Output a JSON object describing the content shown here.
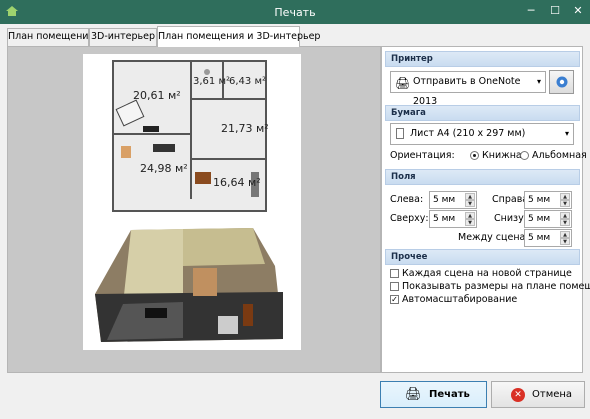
{
  "window": {
    "title": "Печать"
  },
  "tabs": [
    "План помещения",
    "3D-интерьер",
    "План помещения и 3D-интерьер"
  ],
  "preview": {
    "rooms": [
      "20,61 м²",
      "3,61 м²",
      "6,43 м²",
      "21,73 м²",
      "24,98 м²",
      "16,64 м²"
    ]
  },
  "printer": {
    "header": "Принтер",
    "selected": "Отправить в OneNote 2013"
  },
  "paper": {
    "header": "Бумага",
    "selected": "Лист A4 (210 x 297 мм)",
    "orientation_label": "Ориентация:",
    "portrait": "Книжная",
    "landscape": "Альбомная"
  },
  "margins": {
    "header": "Поля",
    "left_label": "Слева:",
    "left": "5 мм",
    "right_label": "Справа:",
    "right": "5 мм",
    "top_label": "Сверху:",
    "top": "5 мм",
    "bottom_label": "Снизу:",
    "bottom": "5 мм",
    "between_label": "Между сценами:",
    "between": "5 мм"
  },
  "other": {
    "header": "Прочее",
    "opt1": "Каждая сцена на новой странице",
    "opt1_checked": false,
    "opt2": "Показывать размеры на плане помещения",
    "opt2_checked": false,
    "opt3": "Автомасштабирование",
    "opt3_checked": true
  },
  "buttons": {
    "print": "Печать",
    "cancel": "Отмена"
  }
}
